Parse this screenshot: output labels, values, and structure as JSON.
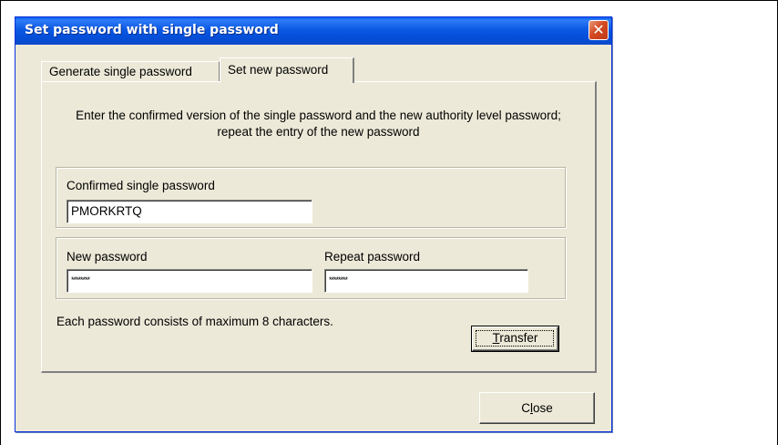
{
  "window": {
    "title": "Set password with single password",
    "close_glyph": "✕"
  },
  "tabs": [
    {
      "label": "Generate single password",
      "selected": false
    },
    {
      "label": "Set new password",
      "selected": true
    }
  ],
  "panel": {
    "instruction_line1": "Enter the confirmed version of the single password and the new authority level password;",
    "instruction_line2": "repeat the entry of the new password",
    "confirmed": {
      "label": "Confirmed single password",
      "value": "PMORKRTQ"
    },
    "new_password": {
      "label": "New password",
      "value": "********"
    },
    "repeat_password": {
      "label": "Repeat password",
      "value": "********"
    },
    "note": "Each password consists of maximum 8 characters.",
    "transfer": {
      "mnemonic": "T",
      "rest": "ransfer"
    }
  },
  "footer": {
    "close": {
      "prefix": "C",
      "mnemonic": "l",
      "rest": "ose"
    }
  },
  "icons": {
    "close": "close-icon"
  },
  "colors": {
    "title_bar": "#0a5ef0",
    "dialog_face": "#ece9d8",
    "close_button": "#d44a22"
  }
}
